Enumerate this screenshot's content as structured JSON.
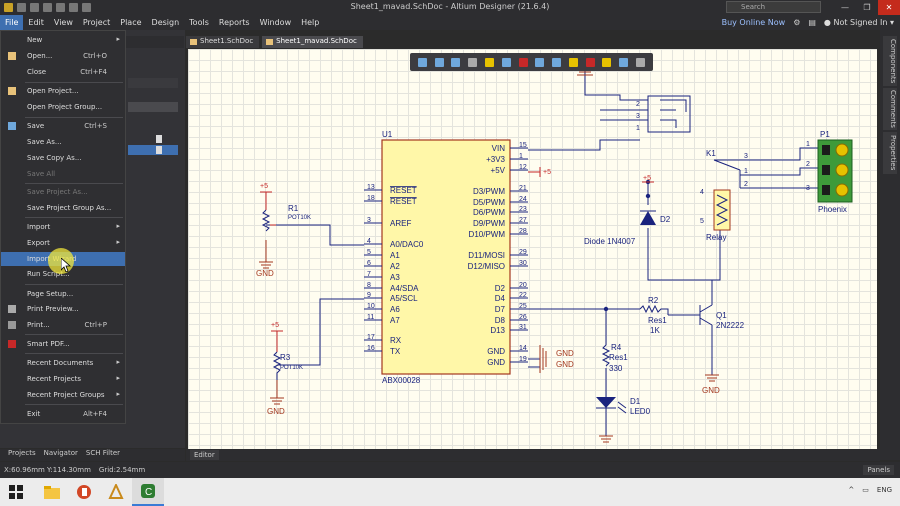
{
  "window": {
    "title": "Sheet1_mavad.SchDoc - Altium Designer (21.6.4)",
    "search_placeholder": "Search",
    "minimize": "—",
    "maximize": "❐",
    "close": "✕"
  },
  "menubar": {
    "items": [
      "File",
      "Edit",
      "View",
      "Project",
      "Place",
      "Design",
      "Tools",
      "Reports",
      "Window",
      "Help"
    ],
    "buy_label": "Buy Online Now",
    "user_label": "Not Signed In",
    "user_caret": "▾"
  },
  "file_menu": {
    "new": {
      "label": "New",
      "shortcut": ""
    },
    "open": {
      "label": "Open...",
      "shortcut": "Ctrl+O"
    },
    "close": {
      "label": "Close",
      "shortcut": "Ctrl+F4"
    },
    "open_project": {
      "label": "Open Project..."
    },
    "open_project_group": {
      "label": "Open Project Group..."
    },
    "save": {
      "label": "Save",
      "shortcut": "Ctrl+S"
    },
    "save_as": {
      "label": "Save As..."
    },
    "save_copy_as": {
      "label": "Save Copy As..."
    },
    "save_all": {
      "label": "Save All"
    },
    "save_project_as": {
      "label": "Save Project As..."
    },
    "save_project_group_as": {
      "label": "Save Project Group As..."
    },
    "import": {
      "label": "Import"
    },
    "export": {
      "label": "Export"
    },
    "import_wizard": {
      "label": "Import Wizard"
    },
    "run_script": {
      "label": "Run Script..."
    },
    "page_setup": {
      "label": "Page Setup..."
    },
    "print_preview": {
      "label": "Print Preview..."
    },
    "print": {
      "label": "Print...",
      "shortcut": "Ctrl+P"
    },
    "smart_pdf": {
      "label": "Smart PDF..."
    },
    "recent_documents": {
      "label": "Recent Documents"
    },
    "recent_projects": {
      "label": "Recent Projects"
    },
    "recent_project_groups": {
      "label": "Recent Project Groups"
    },
    "exit": {
      "label": "Exit",
      "shortcut": "Alt+F4"
    },
    "submenu_arrow": "▸"
  },
  "doc_tabs": [
    "Sheet1.SchDoc",
    "Sheet1_mavad.SchDoc"
  ],
  "left_bottom_tabs": [
    "Projects",
    "Navigator",
    "SCH Filter"
  ],
  "right_tabs": [
    "Components",
    "Comments",
    "Properties"
  ],
  "editor_tab": "Editor",
  "status": {
    "coords": "X:60.96mm Y:114.30mm",
    "grid": "Grid:2.54mm"
  },
  "panels_button": "Panels",
  "tray": {
    "caret": "^",
    "lang": "ENG"
  },
  "schematic": {
    "u1": {
      "ref": "U1",
      "part": "ABX00028",
      "left_pins": [
        {
          "num": "13",
          "name": "RESET"
        },
        {
          "num": "18",
          "name": "RESET"
        },
        {
          "num": "3",
          "name": "AREF"
        },
        {
          "num": "4",
          "name": "A0/DAC0"
        },
        {
          "num": "5",
          "name": "A1"
        },
        {
          "num": "6",
          "name": "A2"
        },
        {
          "num": "7",
          "name": "A3"
        },
        {
          "num": "8",
          "name": "A4/SDA"
        },
        {
          "num": "9",
          "name": "A5/SCL"
        },
        {
          "num": "10",
          "name": "A6"
        },
        {
          "num": "11",
          "name": "A7"
        },
        {
          "num": "17",
          "name": "RX"
        },
        {
          "num": "16",
          "name": "TX"
        }
      ],
      "right_pins": [
        {
          "num": "15",
          "name": "VIN"
        },
        {
          "num": "1",
          "name": "+3V3"
        },
        {
          "num": "12",
          "name": "+5V"
        },
        {
          "num": "21",
          "name": "D3/PWM"
        },
        {
          "num": "24",
          "name": "D5/PWM"
        },
        {
          "num": "23",
          "name": "D6/PWM"
        },
        {
          "num": "27",
          "name": "D9/PWM"
        },
        {
          "num": "28",
          "name": "D10/PWM"
        },
        {
          "num": "29",
          "name": "D11/MOSI"
        },
        {
          "num": "30",
          "name": "D12/MISO"
        },
        {
          "num": "20",
          "name": "D2"
        },
        {
          "num": "22",
          "name": "D4"
        },
        {
          "num": "25",
          "name": "D7"
        },
        {
          "num": "26",
          "name": "D8"
        },
        {
          "num": "31",
          "name": "D13"
        },
        {
          "num": "14",
          "name": "GND"
        },
        {
          "num": "19",
          "name": "GND"
        }
      ]
    },
    "r1": {
      "ref": "R1",
      "val": "POT10K"
    },
    "r3": {
      "ref": "R3",
      "val": "POT10K"
    },
    "r2": {
      "ref": "R2",
      "val1": "Res1",
      "val2": "1K"
    },
    "r4": {
      "ref": "R4",
      "val1": "Res1",
      "val2": "330"
    },
    "d1": {
      "ref": "D1",
      "val": "LED0"
    },
    "d2": {
      "ref": "D2",
      "val": "Diode 1N4007"
    },
    "q1": {
      "ref": "Q1",
      "val": "2N2222"
    },
    "k1": {
      "ref": "K1",
      "val": "Relay",
      "pins": [
        "3",
        "1",
        "2",
        "4",
        "5"
      ]
    },
    "p1": {
      "ref": "P1",
      "val": "Phoenix",
      "pins": [
        "1",
        "2",
        "3"
      ]
    },
    "jack_pins": [
      "2",
      "3",
      "1"
    ],
    "plus5": "+5",
    "gnd": "GND",
    "gnd_net": "GND"
  }
}
